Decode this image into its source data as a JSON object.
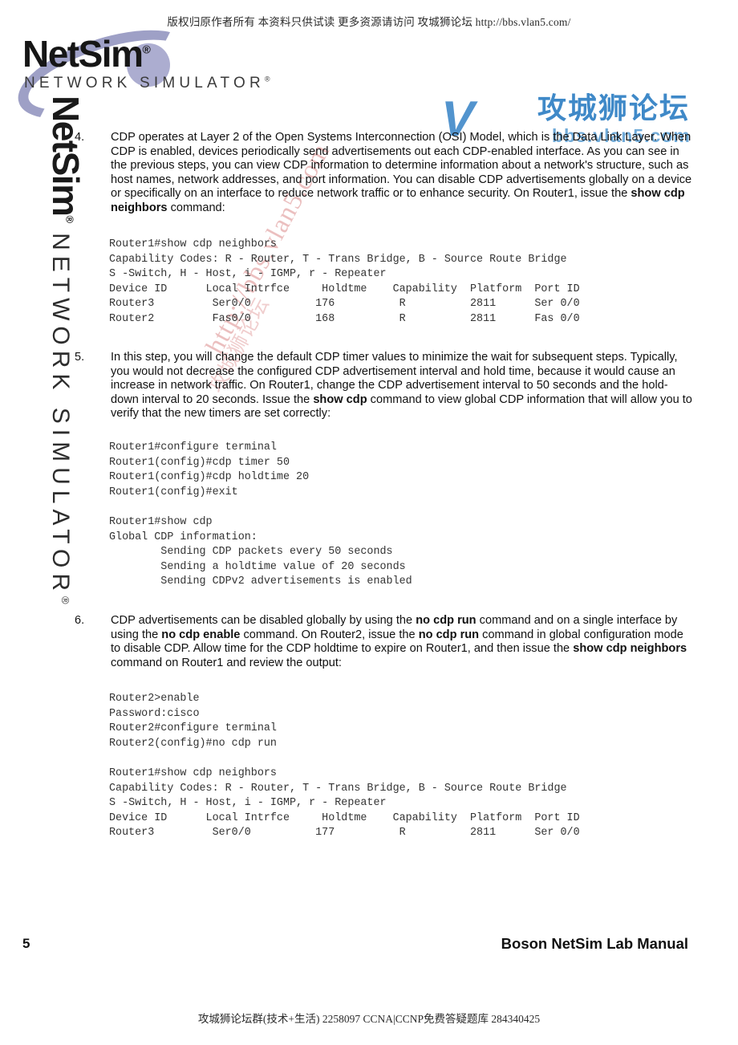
{
  "scan_header": "版权归原作者所有  本资料只供试读  更多资源请访问  攻城狮论坛  http://bbs.vlan5.com/",
  "scan_footer": "攻城狮论坛群(技术+生活)  2258097  CCNA|CCNP免费答疑题库  284340425",
  "logo": {
    "wordmark": "NetSim",
    "wordmark_reg": "®",
    "subtitle": "NETWORK SIMULATOR",
    "subtitle_reg": "®"
  },
  "side_mark": {
    "wordmark": "NetSim",
    "wordmark_reg": "®",
    "subtitle": "NETWORK SIMULATOR",
    "subtitle_reg": "®"
  },
  "watermarks": {
    "blue_letter": "V",
    "blue_chinese": "攻城狮论坛",
    "blue_domain": "bbs.vlan5.com",
    "diagonal_url": "http://bbs.vlan5.com",
    "diagonal_chinese": "攻城狮论坛"
  },
  "steps": [
    {
      "number": "4.",
      "text_html": "CDP operates at Layer 2 of the Open Systems Interconnection (OSI) Model, which is the Data Link Layer. When CDP is enabled, devices periodically send advertisements out each CDP-enabled interface. As you can see in the previous steps, you can view CDP information to determine information about a network's structure, such as host names, network addresses, and port information. You can disable CDP advertisements globally on a device or specifically on an interface to reduce network traffic or to enhance security. On Router1, issue the <b>show cdp neighbors</b> command:"
    },
    {
      "number": "5.",
      "text_html": "In this step, you will change the default CDP timer values to minimize the wait for subsequent steps. Typically, you would not decrease the configured CDP advertisement interval and hold time, because it would cause an increase in network traffic. On Router1, change the CDP advertisement interval to 50 seconds and the hold-down interval to 20 seconds. Issue the <b>show cdp</b> command to view global CDP information that will allow you to verify that the new timers are set correctly:"
    },
    {
      "number": "6.",
      "text_html": "CDP advertisements can be disabled globally by using the <b>no cdp run</b> command and on a single interface by using the <b>no cdp enable</b> command. On Router2, issue the <b>no cdp run</b> command in global configuration mode to disable CDP. Allow time for the CDP holdtime to expire on Router1, and then issue the <b>show cdp neighbors</b> command on Router1 and review the output:"
    }
  ],
  "code_blocks": [
    {
      "id": "code-block-1",
      "lines": "Router1#show cdp neighbors\nCapability Codes: R - Router, T - Trans Bridge, B - Source Route Bridge\nS -Switch, H - Host, i - IGMP, r - Repeater\nDevice ID      Local Intrfce     Holdtme    Capability  Platform  Port ID\nRouter3         Ser0/0          176          R          2811      Ser 0/0\nRouter2         Fas0/0          168          R          2811      Fas 0/0"
    },
    {
      "id": "code-block-2",
      "lines": "Router1#configure terminal\nRouter1(config)#cdp timer 50\nRouter1(config)#cdp holdtime 20\nRouter1(config)#exit\n\nRouter1#show cdp\nGlobal CDP information:\n        Sending CDP packets every 50 seconds\n        Sending a holdtime value of 20 seconds\n        Sending CDPv2 advertisements is enabled"
    },
    {
      "id": "code-block-3",
      "lines": "Router2>enable\nPassword:cisco\nRouter2#configure terminal\nRouter2(config)#no cdp run\n\nRouter1#show cdp neighbors\nCapability Codes: R - Router, T - Trans Bridge, B - Source Route Bridge\nS -Switch, H - Host, i - IGMP, r - Repeater\nDevice ID      Local Intrfce     Holdtme    Capability  Platform  Port ID\nRouter3         Ser0/0          177          R          2811      Ser 0/0"
    }
  ],
  "cdp_neighbor_tables": [
    {
      "id": "neighbors-before",
      "headers": [
        "Device ID",
        "Local Intrfce",
        "Holdtme",
        "Capability",
        "Platform",
        "Port ID"
      ],
      "rows": [
        [
          "Router3",
          "Ser0/0",
          "176",
          "R",
          "2811",
          "Ser 0/0"
        ],
        [
          "Router2",
          "Fas0/0",
          "168",
          "R",
          "2811",
          "Fas 0/0"
        ]
      ]
    },
    {
      "id": "neighbors-after",
      "headers": [
        "Device ID",
        "Local Intrfce",
        "Holdtme",
        "Capability",
        "Platform",
        "Port ID"
      ],
      "rows": [
        [
          "Router3",
          "Ser0/0",
          "177",
          "R",
          "2811",
          "Ser 0/0"
        ]
      ]
    }
  ],
  "footer": {
    "page_number": "5",
    "manual_title": "Boson NetSim Lab Manual"
  }
}
